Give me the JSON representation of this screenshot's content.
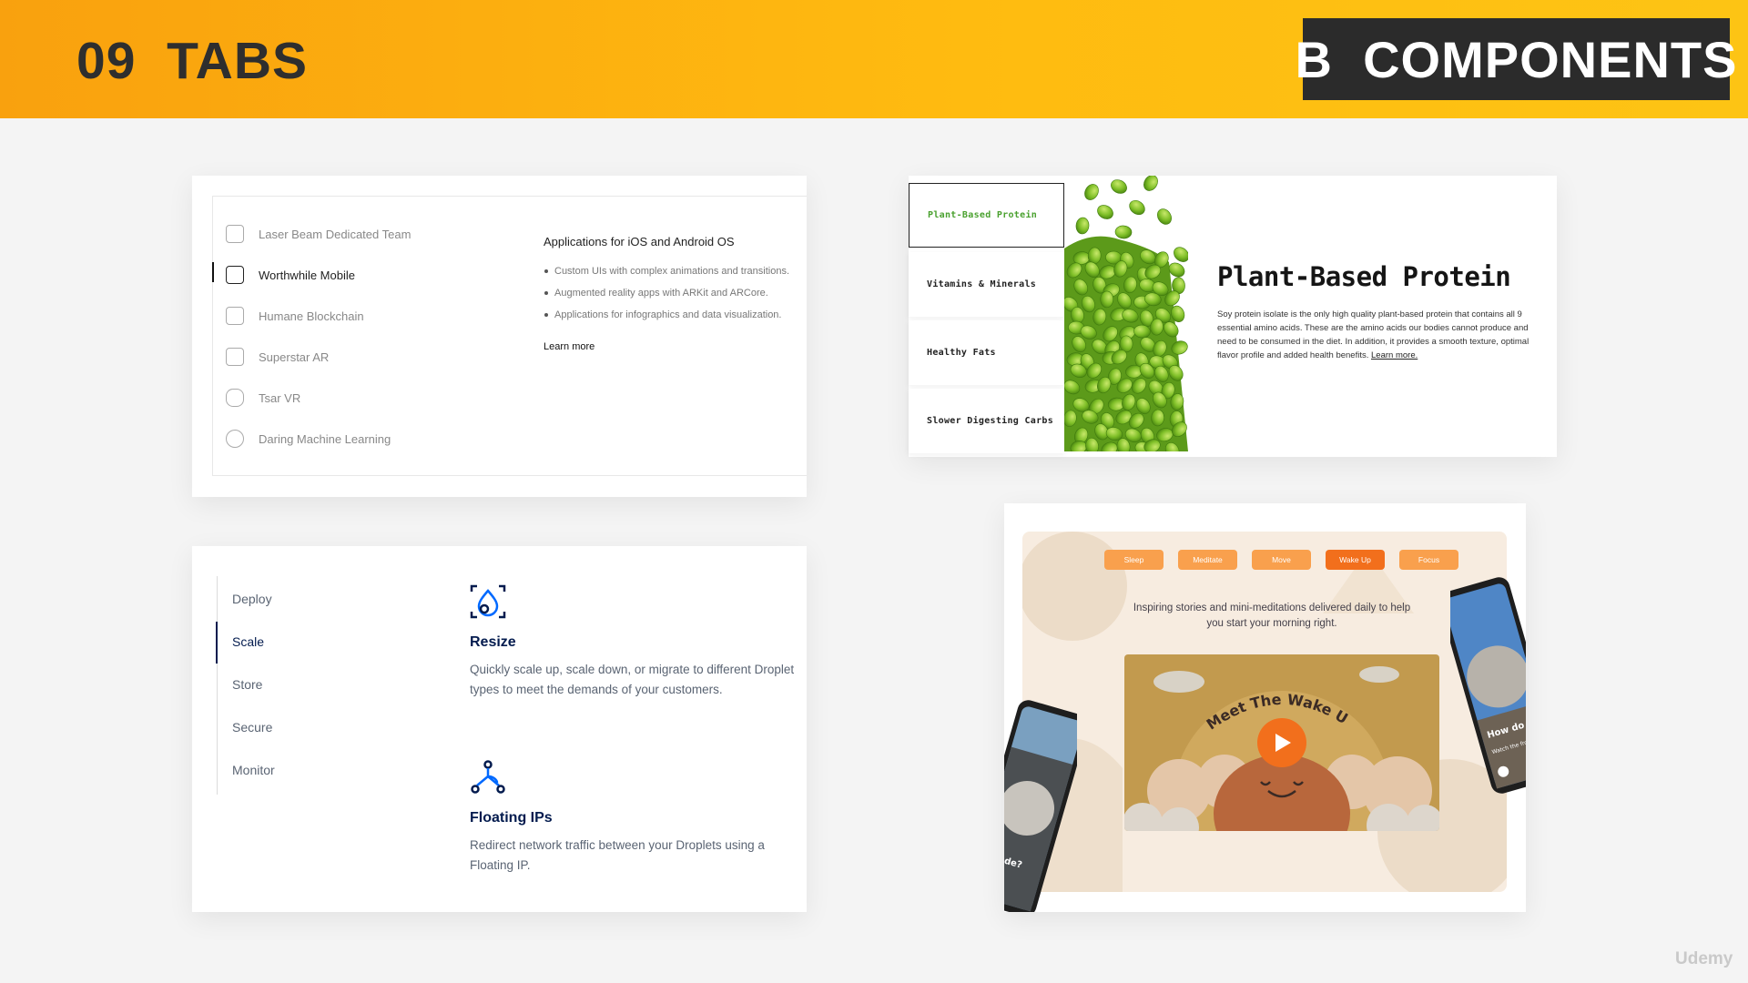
{
  "header": {
    "section": "09  TABS",
    "category": "B  COMPONENTS"
  },
  "card1": {
    "nav_items": [
      {
        "label": "Laser Beam Dedicated Team",
        "icon": "team-icon"
      },
      {
        "label": "Worthwhile Mobile",
        "icon": "mobile-icon",
        "active": true
      },
      {
        "label": "Humane Blockchain",
        "icon": "blockchain-icon"
      },
      {
        "label": "Superstar AR",
        "icon": "ar-icon"
      },
      {
        "label": "Tsar VR",
        "icon": "vr-headset-icon"
      },
      {
        "label": "Daring Machine Learning",
        "icon": "brain-icon"
      }
    ],
    "panel_title": "Applications for iOS and Android OS",
    "bullets": [
      "Custom UIs with complex animations and transitions.",
      "Augmented reality apps with ARKit and ARCore.",
      "Applications for infographics and data visualization."
    ],
    "learn_more": "Learn more"
  },
  "card2": {
    "tabs": [
      "Deploy",
      "Scale",
      "Store",
      "Secure",
      "Monitor"
    ],
    "active_tab": "Scale",
    "features": [
      {
        "icon": "resize-icon",
        "title": "Resize",
        "desc": "Quickly scale up, scale down, or migrate to different Droplet types to meet the demands of your customers."
      },
      {
        "icon": "floating-ip-icon",
        "title": "Floating IPs",
        "desc": "Redirect network traffic between your Droplets using a Floating IP."
      }
    ]
  },
  "card3": {
    "tabs": [
      "Plant-Based Protein",
      "Vitamins & Minerals",
      "Healthy Fats",
      "Slower Digesting Carbs"
    ],
    "active_tab": "Plant-Based Protein",
    "headline": "Plant-Based Protein",
    "body": "Soy protein isolate is the only high quality plant-based protein that contains all 9 essential amino acids. These are the amino acids our bodies cannot produce and need to be consumed in the diet. In addition, it provides a smooth texture, optimal flavor profile and added health benefits.",
    "learn_more": "Learn more.",
    "accent_color": "#4aa12f"
  },
  "card4": {
    "pills": [
      "Sleep",
      "Meditate",
      "Move",
      "Wake Up",
      "Focus"
    ],
    "active_pill": "Wake Up",
    "intro": "Inspiring stories and mini-meditations delivered daily to help you start your morning right.",
    "video_title": "Meet The Wake Up",
    "left_phone_text": "made?",
    "right_phone_text": "How do honey",
    "right_phone_sub": "Watch the from start",
    "accent_color": "#f26f1c"
  },
  "watermark": "Udemy"
}
